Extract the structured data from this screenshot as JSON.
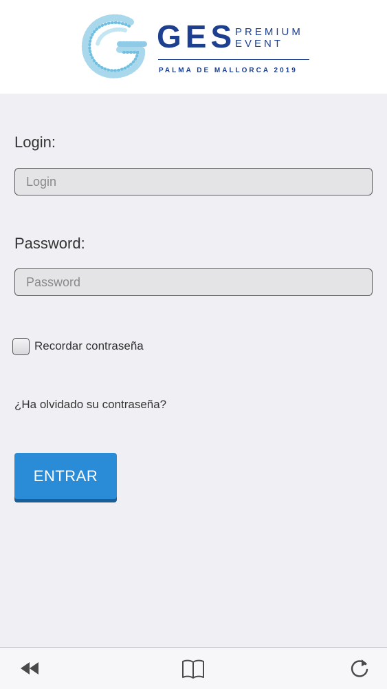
{
  "header": {
    "brand": "GES",
    "brand_word_1": "PREMIUM",
    "brand_word_2": "EVENT",
    "subtitle": "PALMA DE MALLORCA 2019"
  },
  "form": {
    "login_label": "Login:",
    "login_placeholder": "Login",
    "login_value": "",
    "password_label": "Password:",
    "password_placeholder": "Password",
    "password_value": "",
    "remember_label": "Recordar contraseña",
    "remember_checked": false,
    "forgot_link": "¿Ha olvidado su contraseña?",
    "submit_label": "ENTRAR"
  },
  "toolbar": {
    "icons": [
      "rewind-icon",
      "book-icon",
      "reload-icon"
    ]
  },
  "colors": {
    "brand": "#1d3f8f",
    "button": "#2a8cd6",
    "background": "#efeff4"
  }
}
